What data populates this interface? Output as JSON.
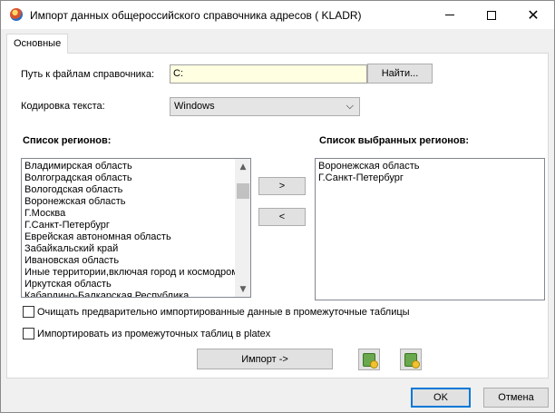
{
  "window": {
    "title": "Импорт данных общероссийского справочника адресов ( KLADR)",
    "app_icon": "kladr-app-icon",
    "controls": {
      "minimize": "minimize-icon",
      "maximize": "maximize-icon",
      "close": "close-icon"
    }
  },
  "tabs": [
    {
      "label": "Основные",
      "active": true
    }
  ],
  "path": {
    "label": "Путь к файлам справочника:",
    "value": "C:",
    "find_button": "Найти...",
    "field_color": "#ffffe1"
  },
  "encoding": {
    "label": "Кодировка текста:",
    "selected": "Windows"
  },
  "regions": {
    "available_label": "Список регионов:",
    "selected_label": "Список выбранных регионов:",
    "available": [
      "Владимирская область",
      "Волгоградская область",
      "Вологодская область",
      "Воронежская область",
      "Г.Москва",
      "Г.Санкт-Петербург",
      "Еврейская автономная область",
      "Забайкальский край",
      "Ивановская область",
      "Иные территории,включая город и космодром Байконур",
      "Иркутская область",
      "Кабардино-Балкарская Республика"
    ],
    "selected": [
      "Воронежская область",
      "Г.Санкт-Петербург"
    ],
    "add_button": ">",
    "remove_button": "<"
  },
  "options": {
    "clear_label": "Очищать предварительно импортированные данные в промежуточные таблицы",
    "clear_checked": false,
    "import_from_label": "Импортировать из промежуточных таблиц в platex",
    "import_from_checked": false
  },
  "actions": {
    "import_button": "Импорт ->",
    "icon1": "database-export-icon",
    "icon2": "database-settings-icon"
  },
  "footer": {
    "ok": "OK",
    "cancel": "Отмена",
    "ok_accent": "#0078d7"
  }
}
